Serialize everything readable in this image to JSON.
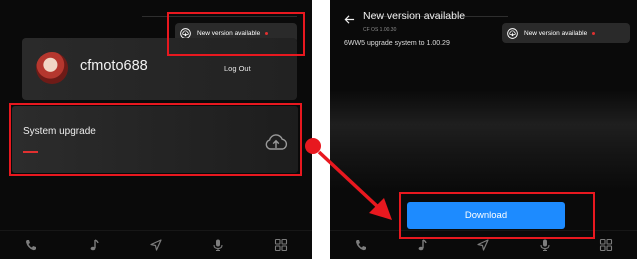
{
  "left": {
    "badge": {
      "icon": "cloud-download-icon",
      "text": "New version available"
    },
    "account": {
      "avatar": "user-avatar",
      "username": "cfmoto688",
      "logout_label": "Log Out"
    },
    "system_upgrade": {
      "label": "System upgrade",
      "icon": "cloud-upload-icon"
    }
  },
  "right": {
    "back_icon": "back-arrow-icon",
    "title": "New version available",
    "subtitle": "CF OS 1.00.30",
    "badge": {
      "icon": "cloud-download-icon",
      "text": "New version available"
    },
    "description": "6WW5 upgrade system to 1.00.29",
    "download_label": "Download"
  },
  "navbar": {
    "items": [
      "phone-icon",
      "music-note-icon",
      "navigation-arrow-icon",
      "microphone-icon",
      "grid-apps-icon"
    ]
  },
  "colors": {
    "highlight": "#e8181f",
    "accent_red": "#e03030",
    "download_blue": "#1d8bff",
    "screen_bg": "#0a0a0a"
  }
}
